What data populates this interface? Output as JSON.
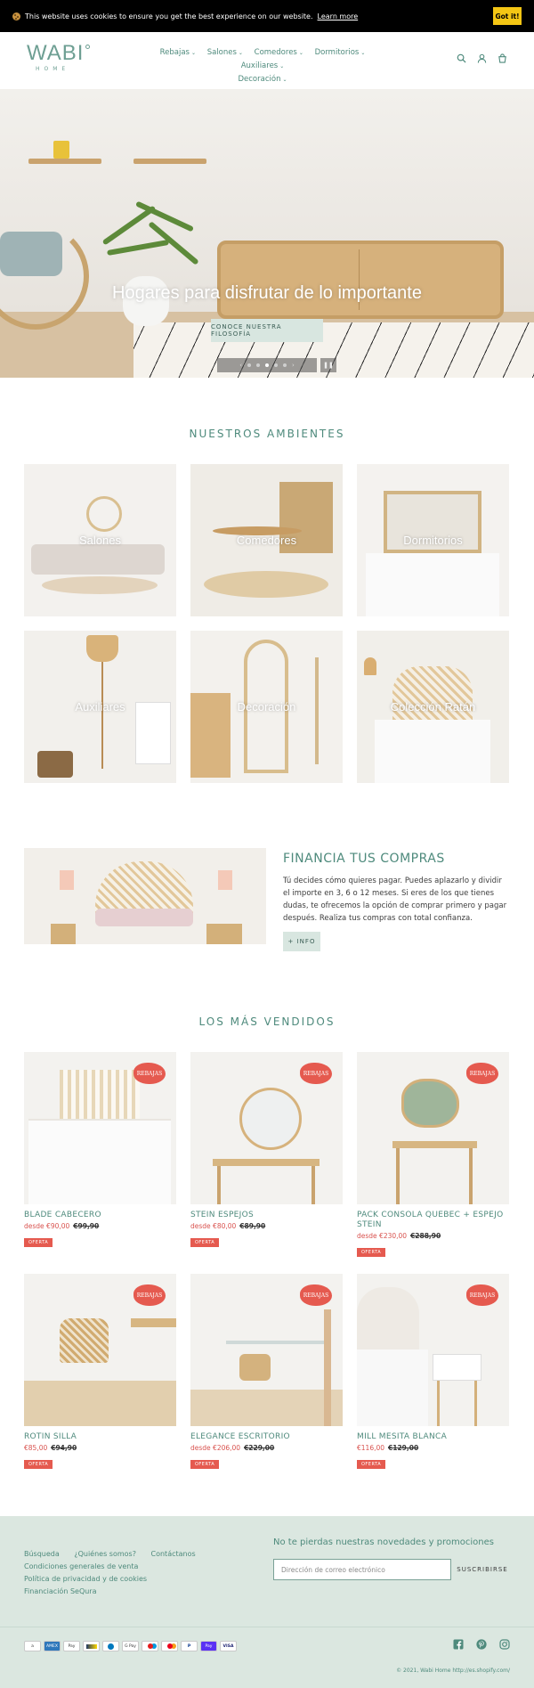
{
  "cookie": {
    "message": "This website uses cookies to ensure you get the best experience on our website.",
    "learn_more": "Learn more",
    "got_it": "Got it!"
  },
  "header": {
    "logo_main": "WABI",
    "logo_sub": "HOME",
    "nav": [
      {
        "label": "Rebajas"
      },
      {
        "label": "Salones"
      },
      {
        "label": "Comedores"
      },
      {
        "label": "Dormitorios"
      },
      {
        "label": "Auxiliares"
      },
      {
        "label": "Decoración"
      }
    ],
    "icons": [
      "search-icon",
      "account-icon",
      "cart-icon"
    ]
  },
  "hero": {
    "title": "Hogares para disfrutar de lo importante",
    "button": "CONOCE NUESTRA FILOSOFÍA",
    "slides": 5,
    "active_slide": 3
  },
  "ambientes": {
    "title": "NUESTROS AMBIENTES",
    "items": [
      {
        "label": "Salones"
      },
      {
        "label": "Comedores"
      },
      {
        "label": "Dormitorios"
      },
      {
        "label": "Auxiliares"
      },
      {
        "label": "Decoración"
      },
      {
        "label": "Colección Ratán"
      }
    ]
  },
  "financia": {
    "title": "FINANCIA TUS COMPRAS",
    "text": "Tú decides cómo quieres pagar. Puedes aplazarlo y dividir el importe en 3, 6 o 12 meses. Si eres de los que tienes dudas, te ofrecemos la opción de comprar primero y pagar después. Realiza tus compras con total confianza.",
    "button": "+ INFO"
  },
  "vendidos": {
    "title": "LOS MÁS VENDIDOS",
    "badge": "REBAJAS",
    "oferta": "OFERTA",
    "products": [
      {
        "name": "BLADE CABECERO",
        "price": "desde €90,00",
        "old": "€99,90"
      },
      {
        "name": "STEIN ESPEJOS",
        "price": "desde €80,00",
        "old": "€89,90"
      },
      {
        "name": "PACK CONSOLA QUEBEC + ESPEJO STEIN",
        "price": "desde €230,00",
        "old": "€288,90"
      },
      {
        "name": "ROTIN SILLA",
        "price": "€85,00",
        "old": "€94,90"
      },
      {
        "name": "ELEGANCE ESCRITORIO",
        "price": "desde €206,00",
        "old": "€229,00"
      },
      {
        "name": "MILL MESITA BLANCA",
        "price": "€116,00",
        "old": "€129,00"
      }
    ]
  },
  "footer": {
    "links": [
      "Búsqueda",
      "¿Quiénes somos?",
      "Contáctanos",
      "Condiciones generales de venta",
      "Política de privacidad y de cookies",
      "Financiación SeQura"
    ],
    "newsletter_title": "No te pierdas nuestras novedades y promociones",
    "email_placeholder": "Dirección de correo electrónico",
    "subscribe": "SUSCRIBIRSE",
    "payments": [
      "Amazon",
      "Amex",
      "Apple Pay",
      "Bancontact",
      "Diners",
      "Google Pay",
      "Maestro",
      "Mastercard",
      "PayPal",
      "Shop Pay",
      "Visa"
    ],
    "payment_labels": [
      "a",
      "AMEX",
      "Pay",
      "",
      "",
      "G Pay",
      "",
      "",
      "P",
      "Pay",
      "VISA"
    ],
    "social": [
      "facebook-icon",
      "pinterest-icon",
      "instagram-icon"
    ],
    "copyright": "© 2021, Wabi Home http://es.shopify.com/"
  },
  "colors": {
    "accent": "#4e8a7c",
    "badge": "#e55a4f",
    "cookie_button": "#f4c614",
    "footer_bg": "#dbe7e0"
  }
}
